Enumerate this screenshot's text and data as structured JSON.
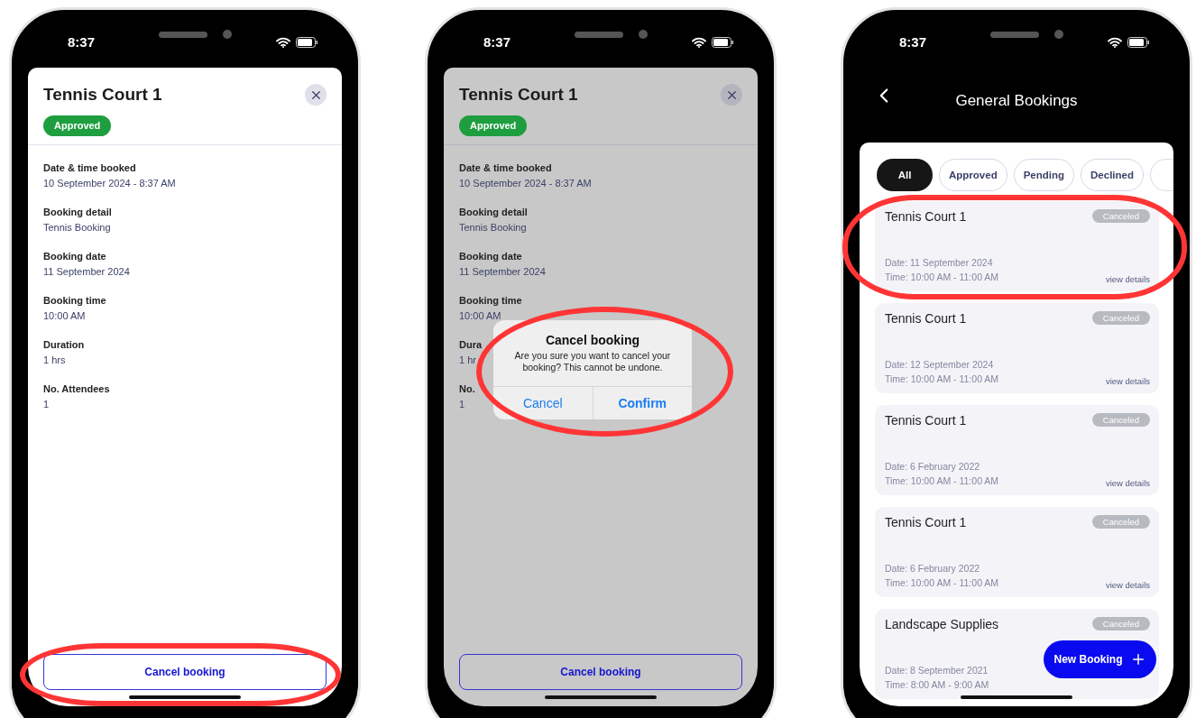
{
  "phones": [
    {
      "kind": "detail",
      "time": "8:37",
      "sheet": {
        "title": "Tennis Court 1",
        "status": "Approved",
        "dimmed": false,
        "action_highlighted": true,
        "fields": [
          {
            "label": "Date & time booked",
            "value": "10 September 2024 - 8:37 AM"
          },
          {
            "label": "Booking detail",
            "value": "Tennis Booking"
          },
          {
            "label": "Booking date",
            "value": "11 September 2024"
          },
          {
            "label": "Booking time",
            "value": "10:00 AM"
          },
          {
            "label": "Duration",
            "value": "1 hrs"
          },
          {
            "label": "No. Attendees",
            "value": "1"
          }
        ],
        "action": "Cancel booking"
      }
    },
    {
      "kind": "detail",
      "time": "8:37",
      "sheet": {
        "title": "Tennis Court 1",
        "status": "Approved",
        "dimmed": true,
        "fields": [
          {
            "label": "Date & time booked",
            "value": "10 September 2024 - 8:37 AM"
          },
          {
            "label": "Booking detail",
            "value": "Tennis Booking"
          },
          {
            "label": "Booking date",
            "value": "11 September 2024"
          },
          {
            "label": "Booking time",
            "value": "10:00 AM"
          },
          {
            "label": "Dura",
            "value": "1 hr"
          },
          {
            "label": "No.",
            "value": "1"
          }
        ],
        "action": "Cancel booking"
      },
      "dialog": {
        "highlighted": true,
        "title": "Cancel booking",
        "message": "Are you sure you want to cancel your booking? This cannot be undone.",
        "buttons": [
          "Cancel",
          "Confirm"
        ]
      }
    },
    {
      "kind": "list",
      "time": "8:37",
      "title": "General Bookings",
      "filters": [
        {
          "label": "All",
          "selected": true
        },
        {
          "label": "Approved",
          "selected": false
        },
        {
          "label": "Pending",
          "selected": false
        },
        {
          "label": "Declined",
          "selected": false
        }
      ],
      "bookings": [
        {
          "title": "Tennis Court 1",
          "status": "Canceled",
          "date": "Date: 11 September 2024",
          "time": "Time: 10:00 AM - 11:00 AM",
          "link": "view details",
          "highlighted": true
        },
        {
          "title": "Tennis Court 1",
          "status": "Canceled",
          "date": "Date: 12 September 2024",
          "time": "Time: 10:00 AM - 11:00 AM",
          "link": "view details",
          "highlighted": false
        },
        {
          "title": "Tennis Court 1",
          "status": "Canceled",
          "date": "Date: 6 February 2022",
          "time": "Time: 10:00 AM - 11:00 AM",
          "link": "view details"
        },
        {
          "title": "Tennis Court 1",
          "status": "Canceled",
          "date": "Date: 6 February 2022",
          "time": "Time: 10:00 AM - 11:00 AM",
          "link": "view details"
        },
        {
          "title": "Landscape Supplies",
          "status": "Canceled",
          "date": "Date: 8 September 2021",
          "time": "Time: 8:00 AM - 9:00 AM"
        }
      ],
      "fab": "New Booking"
    }
  ]
}
